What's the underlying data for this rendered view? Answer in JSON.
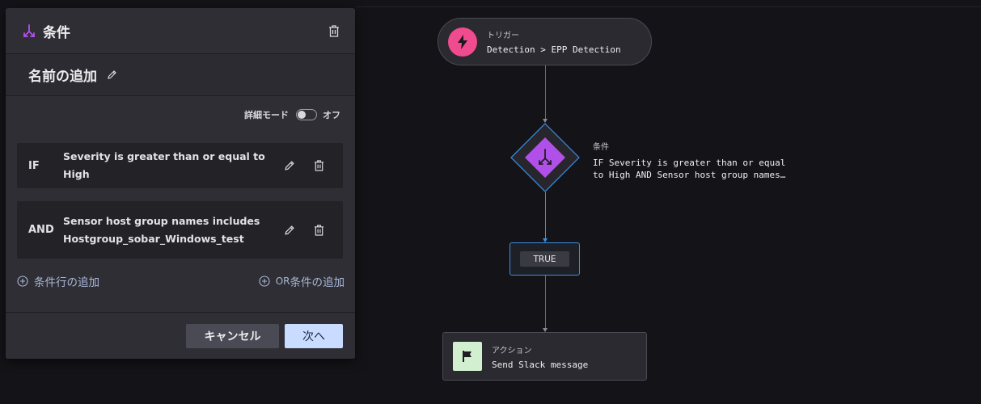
{
  "panel": {
    "title": "条件",
    "name_placeholder": "名前の追加",
    "advanced_mode_label": "詳細モード",
    "advanced_mode_state": "オフ",
    "conditions": [
      {
        "operator": "IF",
        "line1": "Severity is greater than or equal to High",
        "line2": ""
      },
      {
        "operator": "AND",
        "line1": "Sensor host group names includes",
        "line2": "Hostgroup_sobar_Windows_test"
      }
    ],
    "add_condition_row": "条件行の追加",
    "add_or_prefix": "OR",
    "add_or_suffix": "条件の追加",
    "cancel_label": "キャンセル",
    "next_label": "次へ"
  },
  "workflow": {
    "trigger": {
      "label": "トリガー",
      "value": "Detection > EPP Detection"
    },
    "condition": {
      "label": "条件",
      "line1": "IF Severity is greater than or equal",
      "line2": "to High AND Sensor host group names…"
    },
    "true_label": "TRUE",
    "action": {
      "label": "アクション",
      "value": "Send Slack message"
    }
  },
  "colors": {
    "trigger_icon_bg": "#ef4b8e",
    "condition_accent": "#b150e8",
    "true_border": "#3d8ee6",
    "action_icon_bg": "#d2f0cf",
    "next_button_bg": "#c9dcff"
  }
}
